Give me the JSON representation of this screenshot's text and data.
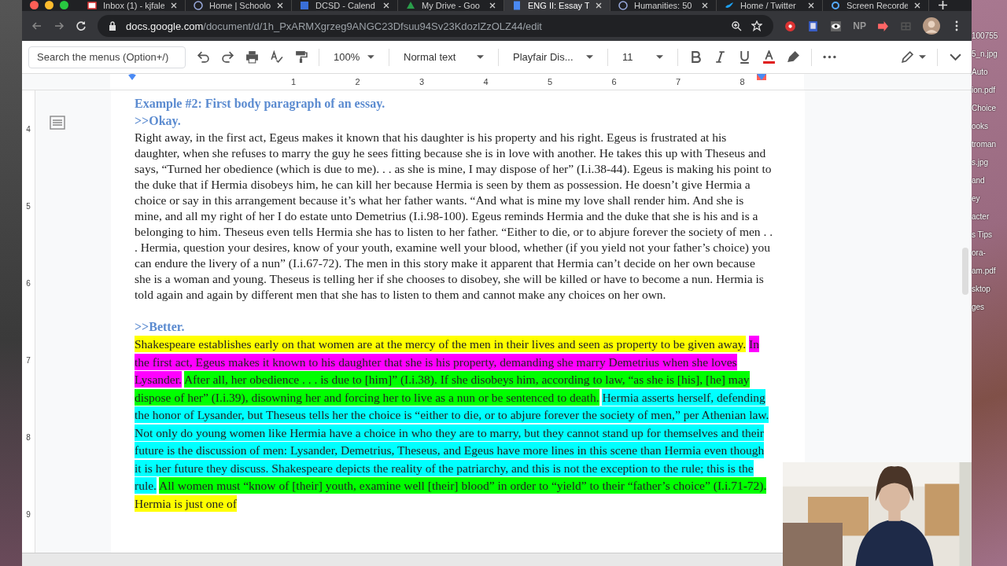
{
  "browser": {
    "tabs": [
      {
        "title": "Inbox (1) - kjfale",
        "selected": false
      },
      {
        "title": "Home | Schoolo",
        "selected": false
      },
      {
        "title": "DCSD - Calend",
        "selected": false
      },
      {
        "title": "My Drive - Goo",
        "selected": false
      },
      {
        "title": "ENG II: Essay T",
        "selected": true
      },
      {
        "title": "Humanities: 50",
        "selected": false
      },
      {
        "title": "Home / Twitter",
        "selected": false
      },
      {
        "title": "Screen Recorde",
        "selected": false
      }
    ],
    "url_host": "docs.google.com",
    "url_path": "/document/d/1h_PxARMXgrzeg9ANGC23Dfsuu94Sv23KdozlZzOLZ44/edit",
    "extension_label": "NP"
  },
  "toolbar": {
    "search_placeholder": "Search the menus (Option+/)",
    "zoom": "100%",
    "style": "Normal text",
    "font": "Playfair Dis...",
    "size": "11"
  },
  "ruler": [
    "1",
    "2",
    "3",
    "4",
    "5",
    "6",
    "7",
    "8"
  ],
  "vertical_ruler": [
    "4",
    "5",
    "6",
    "7",
    "8",
    "9"
  ],
  "document": {
    "heading": "Example #2: First body paragraph of an essay.",
    "sections": [
      {
        "label": ">>Okay.",
        "segments": [
          {
            "text": "Right away, in the first act, Egeus makes it known that his daughter is his property and his right. Egeus is frustrated at his daughter, when she refuses to marry the guy he sees fitting because she is in love with another. He takes this up with Theseus and says, “Turned her obedience (which is due to me). . . as she is mine, I may dispose of her” (I.i.38-44). Egeus is making his point to the duke that if Hermia disobeys him, he can kill her because Hermia is seen by them as possession. He doesn’t give Hermia a choice or say in this arrangement because it’s what her father wants. “And what is mine my love shall render him. And she is mine, and all my right of her I do estate unto Demetrius (I.i.98-100). Egeus reminds Hermia and the duke that she is his and is a belonging to him. Theseus even tells Hermia she has to listen to her father. “Either to die, or to abjure forever the society of men . . . Hermia, question your desires, know of your youth, examine well your blood, whether (if you yield not your father’s choice) you can endure the livery of a nun” (I.i.67-72). The men in this story make it apparent that Hermia can’t decide on her own because she is a woman and young. Theseus is telling her if she chooses to disobey, she will be killed or have to become a nun. Hermia is told again and again by different men that she has to listen to them and cannot make any choices on her own."
          }
        ]
      },
      {
        "label": ">>Better.",
        "segments": [
          {
            "text": "Shakespeare establishes early on that women are at the mercy of the men in their lives and seen as property to be given away.",
            "color": "#ffff00"
          },
          {
            "text": "In the first act, Egeus makes it known to his daughter that she is his property, demanding she marry Demetrius when she loves Lysander.",
            "color": "#ff00ff"
          },
          {
            "text": "After all, her obedience . . . is due to [him]” (I.i.38). If she disobeys him, according to law, “as she is [his], [he] may dispose of her” (I.i.39), disowning her and forcing her to live as a nun or be sentenced to death.",
            "color": "#00ff00"
          },
          {
            "text": "Hermia asserts herself, defending the honor of Lysander, but Theseus tells her the choice is “either to die, or to abjure forever the society of men,” per Athenian law. Not only do young women like Hermia have a choice in who they are to marry, but they cannot stand up for themselves and their future is the discussion of men: Lysander, Demetrius, Theseus, and Egeus have more lines in this scene than Hermia even though it is her future they discuss. Shakespeare depicts the reality of the patriarchy, and this is not the exception to the rule; this is the rule.",
            "color": "#00ffff"
          },
          {
            "text": "All women must “know of [their] youth, examine well [their] blood” in order to “yield” to their “father’s choice” (I.i.71-72).",
            "color": "#00ff00"
          },
          {
            "text": "Hermia is just one of",
            "color": "#ffff00"
          }
        ]
      }
    ]
  },
  "desktop_labels": [
    "100755",
    "5_n.jpg",
    "Auto",
    "ion.pdf",
    "Choice",
    "ooks",
    "troman",
    "s.jpg",
    "and",
    "ey",
    "acter",
    "s Tips",
    "ora-",
    "am.pdf",
    "sktop",
    "ges"
  ]
}
